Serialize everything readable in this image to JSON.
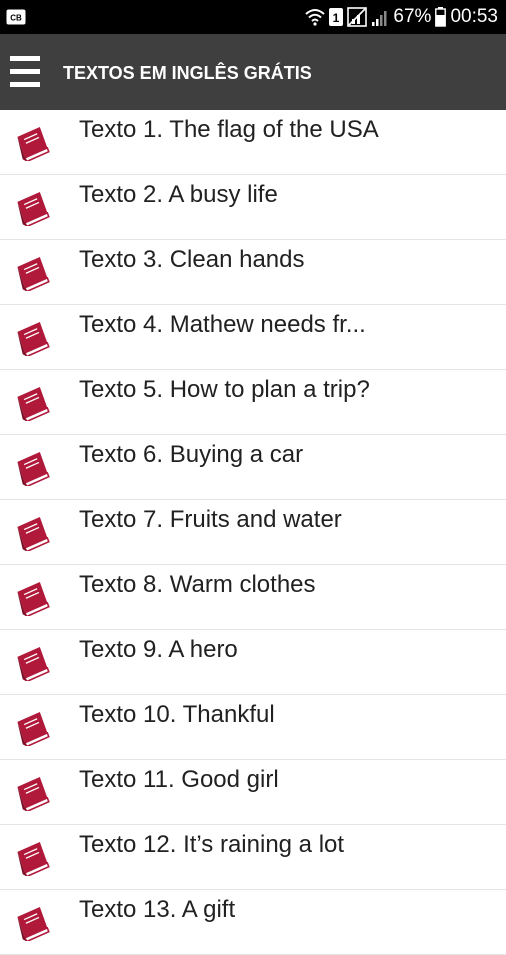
{
  "status_bar": {
    "battery": "67%",
    "time": "00:53"
  },
  "toolbar": {
    "title": "TEXTOS EM INGLÊS GRÁTIS",
    "menu_icon": "hamburger-menu-icon"
  },
  "list": {
    "item_icon": "book-icon",
    "icon_color": "#b0193a",
    "items": [
      {
        "label": "Texto 1. The flag of the USA"
      },
      {
        "label": "Texto 2. A busy life"
      },
      {
        "label": "Texto 3. Clean hands"
      },
      {
        "label": "Texto 4. Mathew needs fr..."
      },
      {
        "label": "Texto 5. How to plan a trip?"
      },
      {
        "label": "Texto 6. Buying a car"
      },
      {
        "label": "Texto 7. Fruits and water"
      },
      {
        "label": "Texto 8. Warm clothes"
      },
      {
        "label": "Texto 9. A hero"
      },
      {
        "label": "Texto 10. Thankful"
      },
      {
        "label": "Texto 11. Good girl"
      },
      {
        "label": "Texto 12. It’s raining a lot"
      },
      {
        "label": "Texto 13. A gift"
      }
    ]
  }
}
